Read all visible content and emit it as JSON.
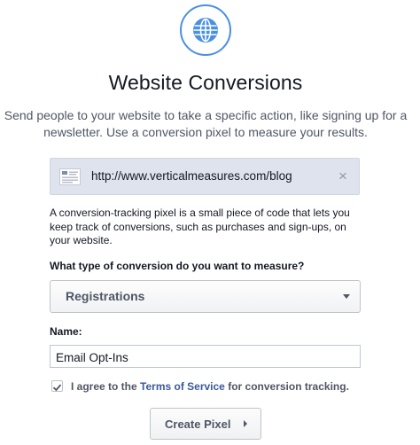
{
  "header": {
    "icon": "globe-icon",
    "title": "Website Conversions",
    "subtitle": "Send people to your website to take a specific action, like signing up for a newsletter. Use a conversion pixel to measure your results."
  },
  "url_box": {
    "thumbnail_icon": "page-thumbnail-icon",
    "url": "http://www.verticalmeasures.com/blog",
    "remove_icon": "close-icon",
    "remove_glyph": "×"
  },
  "description": "A conversion-tracking pixel is a small piece of code that lets you keep track of conversions, such as purchases and sign-ups, on your website.",
  "conversion_type": {
    "label": "What type of conversion do you want to measure?",
    "selected": "Registrations",
    "caret_icon": "caret-down-icon"
  },
  "name_field": {
    "label": "Name:",
    "value": "Email Opt-Ins"
  },
  "agreement": {
    "checked": true,
    "prefix": "I agree to the",
    "link": "Terms of Service",
    "suffix": "for conversion tracking."
  },
  "create_button": {
    "label": "Create Pixel",
    "caret_icon": "caret-right-icon"
  },
  "colors": {
    "accent_blue": "#4a90e2",
    "link_blue": "#3b5998",
    "url_box_bg": "#dfe3ee"
  }
}
